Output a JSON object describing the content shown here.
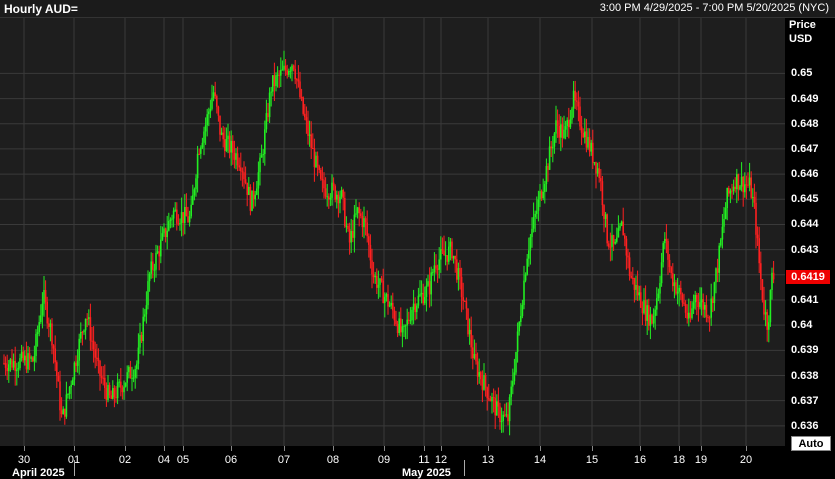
{
  "header": {
    "title": "Hourly AUD=",
    "range": "3:00 PM 4/29/2025 - 7:00 PM 5/20/2025 (NYC)"
  },
  "yaxis": {
    "unit_line1": "Price",
    "unit_line2": "USD",
    "last_label": "0.6419"
  },
  "controls": {
    "auto_label": "Auto"
  },
  "colors": {
    "up": "#22ee22",
    "down": "#ff2020",
    "last_badge": "#e00000",
    "grid": "#3a3a3a",
    "background": "#1e1e1e"
  },
  "chart_data": {
    "type": "candlestick",
    "ylim": [
      0.6352,
      0.6522
    ],
    "y_ticks": [
      "0.65",
      "0.649",
      "0.648",
      "0.647",
      "0.646",
      "0.645",
      "0.644",
      "0.643",
      "0.642",
      "0.641",
      "0.64",
      "0.639",
      "0.638",
      "0.637",
      "0.636"
    ],
    "x_ticks": [
      "30",
      "01",
      "02",
      "04",
      "05",
      "06",
      "07",
      "08",
      "09",
      "11",
      "12",
      "13",
      "14",
      "15",
      "16",
      "18",
      "19",
      "20"
    ],
    "x_months": [
      "April 2025",
      "May 2025"
    ],
    "last_price": 0.6419,
    "path": [
      [
        "30",
        0.6386
      ],
      [
        "30",
        0.6412
      ],
      [
        "30",
        0.6395
      ],
      [
        "30",
        0.6362
      ],
      [
        "01",
        0.6405
      ],
      [
        "01",
        0.6382
      ],
      [
        "01",
        0.637
      ],
      [
        "02",
        0.6385
      ],
      [
        "02",
        0.642
      ],
      [
        "04",
        0.6445
      ],
      [
        "05",
        0.6442
      ],
      [
        "05",
        0.647
      ],
      [
        "05",
        0.648
      ],
      [
        "05",
        0.6493
      ],
      [
        "05",
        0.6475
      ],
      [
        "06",
        0.6465
      ],
      [
        "06",
        0.6448
      ],
      [
        "06",
        0.6465
      ],
      [
        "06",
        0.6495
      ],
      [
        "07",
        0.6505
      ],
      [
        "07",
        0.6485
      ],
      [
        "07",
        0.647
      ],
      [
        "07",
        0.6455
      ],
      [
        "08",
        0.6452
      ],
      [
        "08",
        0.6432
      ],
      [
        "08",
        0.6445
      ],
      [
        "08",
        0.644
      ],
      [
        "08",
        0.642
      ],
      [
        "09",
        0.6405
      ],
      [
        "09",
        0.6395
      ],
      [
        "09",
        0.6408
      ],
      [
        "11",
        0.6415
      ],
      [
        "11",
        0.6425
      ],
      [
        "12",
        0.643
      ],
      [
        "12",
        0.641
      ],
      [
        "12",
        0.6385
      ],
      [
        "13",
        0.6365
      ],
      [
        "13",
        0.6362
      ],
      [
        "13",
        0.6395
      ],
      [
        "13",
        0.643
      ],
      [
        "14",
        0.6465
      ],
      [
        "14",
        0.648
      ],
      [
        "14",
        0.6475
      ],
      [
        "14",
        0.649
      ],
      [
        "14",
        0.648
      ],
      [
        "15",
        0.646
      ],
      [
        "15",
        0.6435
      ],
      [
        "15",
        0.643
      ],
      [
        "15",
        0.644
      ],
      [
        "15",
        0.642
      ],
      [
        "16",
        0.6405
      ],
      [
        "16",
        0.6402
      ],
      [
        "16",
        0.6415
      ],
      [
        "16",
        0.6435
      ],
      [
        "16",
        0.642
      ],
      [
        "18",
        0.6408
      ],
      [
        "18",
        0.64
      ],
      [
        "18",
        0.6412
      ],
      [
        "19",
        0.6405
      ],
      [
        "19",
        0.6425
      ],
      [
        "19",
        0.645
      ],
      [
        "19",
        0.6458
      ],
      [
        "20",
        0.6455
      ],
      [
        "20",
        0.6445
      ],
      [
        "20",
        0.6425
      ],
      [
        "20",
        0.6408
      ],
      [
        "20",
        0.64
      ],
      [
        "20",
        0.6419
      ]
    ]
  }
}
